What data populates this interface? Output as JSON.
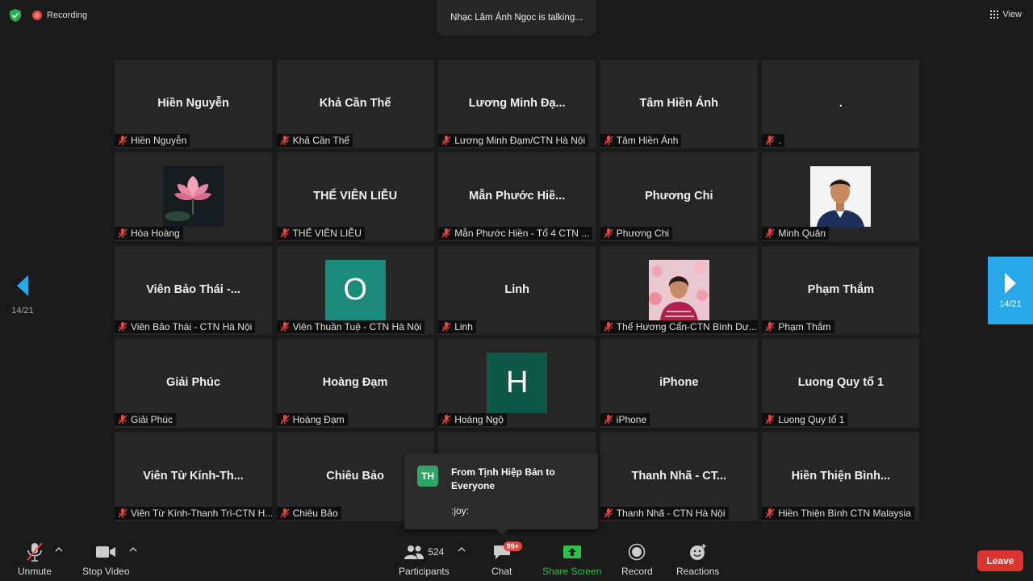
{
  "top": {
    "recording_label": "Recording",
    "talking_text": "Nhạc Lâm Ánh Ngọc is talking...",
    "view_label": "View"
  },
  "navigation": {
    "page_left": "14/21",
    "page_right": "14/21"
  },
  "tiles": [
    {
      "display": "Hiền Nguyễn",
      "label": "Hiền Nguyễn"
    },
    {
      "display": "Khả Cần Thể",
      "label": "Khả Cần Thể"
    },
    {
      "display": "Lương Minh Đạ...",
      "label": "Lương Minh Đạm/CTN Hà Nội"
    },
    {
      "display": "Tâm Hiền Ánh",
      "label": "Tâm Hiền Ánh"
    },
    {
      "display": ".",
      "label": "."
    },
    {
      "display": "",
      "label": "Hòa Hoàng"
    },
    {
      "display": "THỂ VIÊN LIỄU",
      "label": "THỂ VIÊN LIỄU"
    },
    {
      "display": "Mẫn Phước Hiề...",
      "label": "Mẫn Phước Hiền - Tổ 4 CTN ..."
    },
    {
      "display": "Phương Chi",
      "label": "Phương Chi"
    },
    {
      "display": "",
      "label": "Minh Quân"
    },
    {
      "display": "Viên Bảo Thái -...",
      "label": "Viên Bảo Thái - CTN Hà Nội"
    },
    {
      "display": "O",
      "label": "Viên Thuần Tuệ - CTN Hà Nội"
    },
    {
      "display": "Linh",
      "label": "Linh"
    },
    {
      "display": "",
      "label": "Thể Hương Cẩn-CTN Bình Dư..."
    },
    {
      "display": "Phạm Thắm",
      "label": "Phạm Thắm"
    },
    {
      "display": "Giải Phúc",
      "label": "Giải Phúc"
    },
    {
      "display": "Hoàng Đạm",
      "label": "Hoàng Đạm"
    },
    {
      "display": "H",
      "label": "Hoàng Ngộ"
    },
    {
      "display": "iPhone",
      "label": "iPhone"
    },
    {
      "display": "Luong Quy tổ 1",
      "label": "Luong Quy tổ 1"
    },
    {
      "display": "Viên Từ Kính-Th...",
      "label": "Viên Từ Kính-Thanh Trì-CTN H..."
    },
    {
      "display": "Chiêu Bảo",
      "label": "Chiêu Bảo"
    },
    {
      "display": "",
      "label": ""
    },
    {
      "display": "Thanh Nhã - CT...",
      "label": "Thanh Nhã - CTN Hà Nội"
    },
    {
      "display": "Hiền Thiện Bình...",
      "label": "Hiền Thiện Bình  CTN Malaysia"
    }
  ],
  "chat_popup": {
    "avatar_initials": "TH",
    "from_text": "From Tịnh Hiệp Bản to Everyone",
    "message": ":joy:"
  },
  "toolbar": {
    "unmute": "Unmute",
    "stop_video": "Stop Video",
    "participants": "Participants",
    "participant_count": "524",
    "chat": "Chat",
    "chat_badge": "99+",
    "share_screen": "Share Screen",
    "record": "Record",
    "reactions": "Reactions",
    "leave": "Leave"
  },
  "colors": {
    "background": "#1a1a1a",
    "tile": "#262626",
    "accent_blue": "#28a8e8",
    "share_green": "#2fc24b",
    "leave_red": "#d9342f",
    "avatar_o": "#1a8a7a",
    "avatar_h": "#0f5746"
  }
}
